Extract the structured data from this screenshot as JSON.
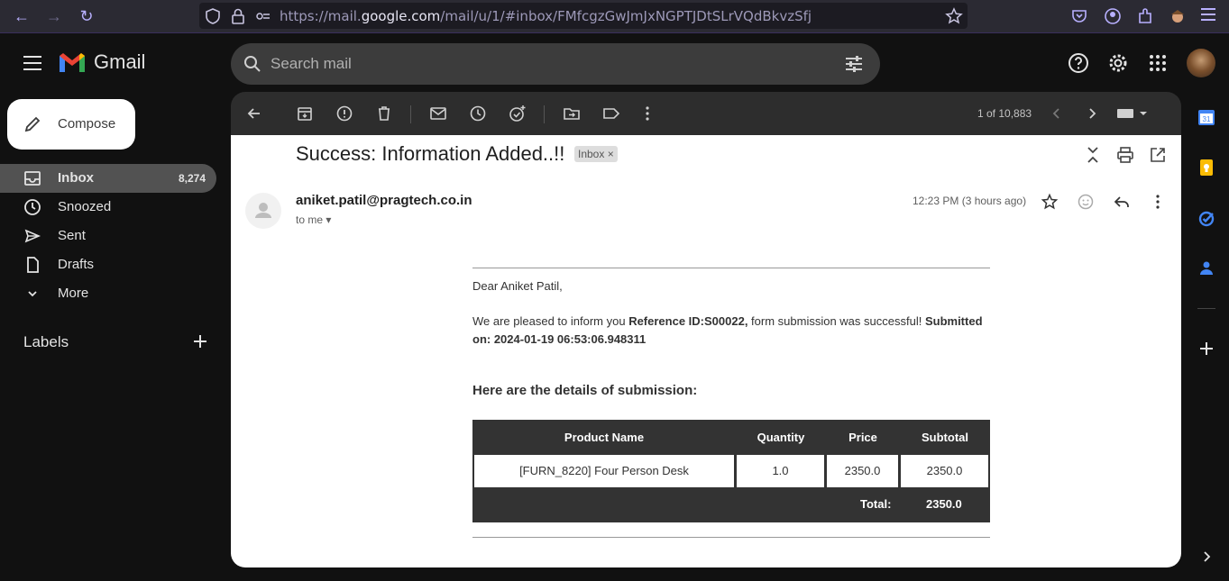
{
  "browser": {
    "url_prefix": "https://mail.",
    "url_domain": "google.com",
    "url_suffix": "/mail/u/1/#inbox/FMfcgzGwJmJxNGPTJDtSLrVQdBkvzSfj"
  },
  "app": {
    "name": "Gmail"
  },
  "search": {
    "placeholder": "Search mail"
  },
  "compose": {
    "label": "Compose"
  },
  "sidebar": {
    "items": [
      {
        "label": "Inbox",
        "count": "8,274"
      },
      {
        "label": "Snoozed",
        "count": ""
      },
      {
        "label": "Sent",
        "count": ""
      },
      {
        "label": "Drafts",
        "count": ""
      },
      {
        "label": "More",
        "count": ""
      }
    ],
    "labels_title": "Labels"
  },
  "toolbar": {
    "pager": "1 of 10,883"
  },
  "message": {
    "subject": "Success: Information Added..!!",
    "chip": "Inbox",
    "chip_close": "×",
    "sender": "aniket.patil@pragtech.co.in",
    "to": "to me",
    "date": "12:23 PM (3 hours ago)",
    "greeting": "Dear Aniket Patil,",
    "body_1": "We are pleased to inform you ",
    "body_ref": "Reference ID:S00022,",
    "body_2": " form submission was successful! ",
    "body_submitted": "Submitted on: 2024-01-19 06:53:06.948311",
    "details_heading": "Here are the details of submission:",
    "table": {
      "headers": [
        "Product Name",
        "Quantity",
        "Price",
        "Subtotal"
      ],
      "row": [
        "[FURN_8220] Four Person Desk",
        "1.0",
        "2350.0",
        "2350.0"
      ],
      "total_label": "Total:",
      "total_value": "2350.0"
    }
  },
  "colors": {
    "brand_red": "#ea4335",
    "brand_blue": "#4285f4",
    "accent_purple": "#b8b0ff"
  }
}
